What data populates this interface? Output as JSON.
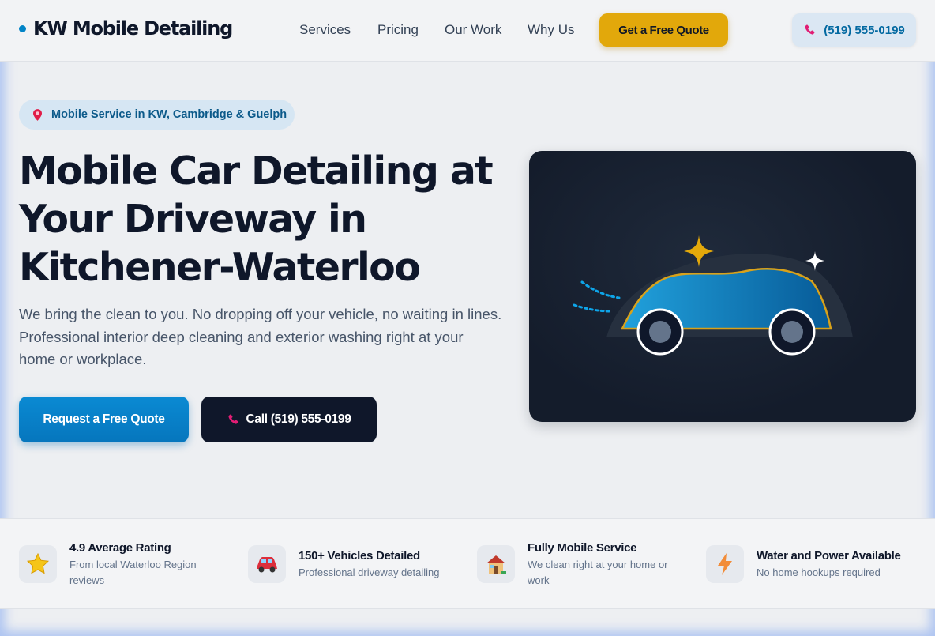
{
  "header": {
    "logo": "KW Mobile Detailing",
    "nav": [
      "Services",
      "Pricing",
      "Our Work",
      "Why Us"
    ],
    "quote_button": "Get a Free Quote",
    "phone_button": "(519) 555-0199"
  },
  "hero": {
    "badge": "Mobile Service in KW, Cambridge & Guelph",
    "title_lines": [
      "Mobile Car Detailing at",
      "Your Driveway in",
      "Kitchener-Waterloo"
    ],
    "description": "We bring the clean to you. No dropping off your vehicle, no waiting in lines. Professional interior deep cleaning and exterior washing right at your home or workplace.",
    "primary_button": "Request a Free Quote",
    "call_button": "Call (519) 555-0199"
  },
  "features": [
    {
      "icon": "star-icon",
      "title": "4.9 Average Rating",
      "subtitle": "From local Waterloo Region reviews"
    },
    {
      "icon": "car-icon",
      "title": "150+ Vehicles Detailed",
      "subtitle": "Professional driveway detailing"
    },
    {
      "icon": "house-icon",
      "title": "Fully Mobile Service",
      "subtitle": "We clean right at your home or work"
    },
    {
      "icon": "lightning-icon",
      "title": "Water and Power Available",
      "subtitle": "No home hookups required"
    }
  ],
  "colors": {
    "primary": "#0284c7",
    "accent": "#e2a80b",
    "dark": "#0f172a",
    "phone_icon": "#e11d74"
  }
}
